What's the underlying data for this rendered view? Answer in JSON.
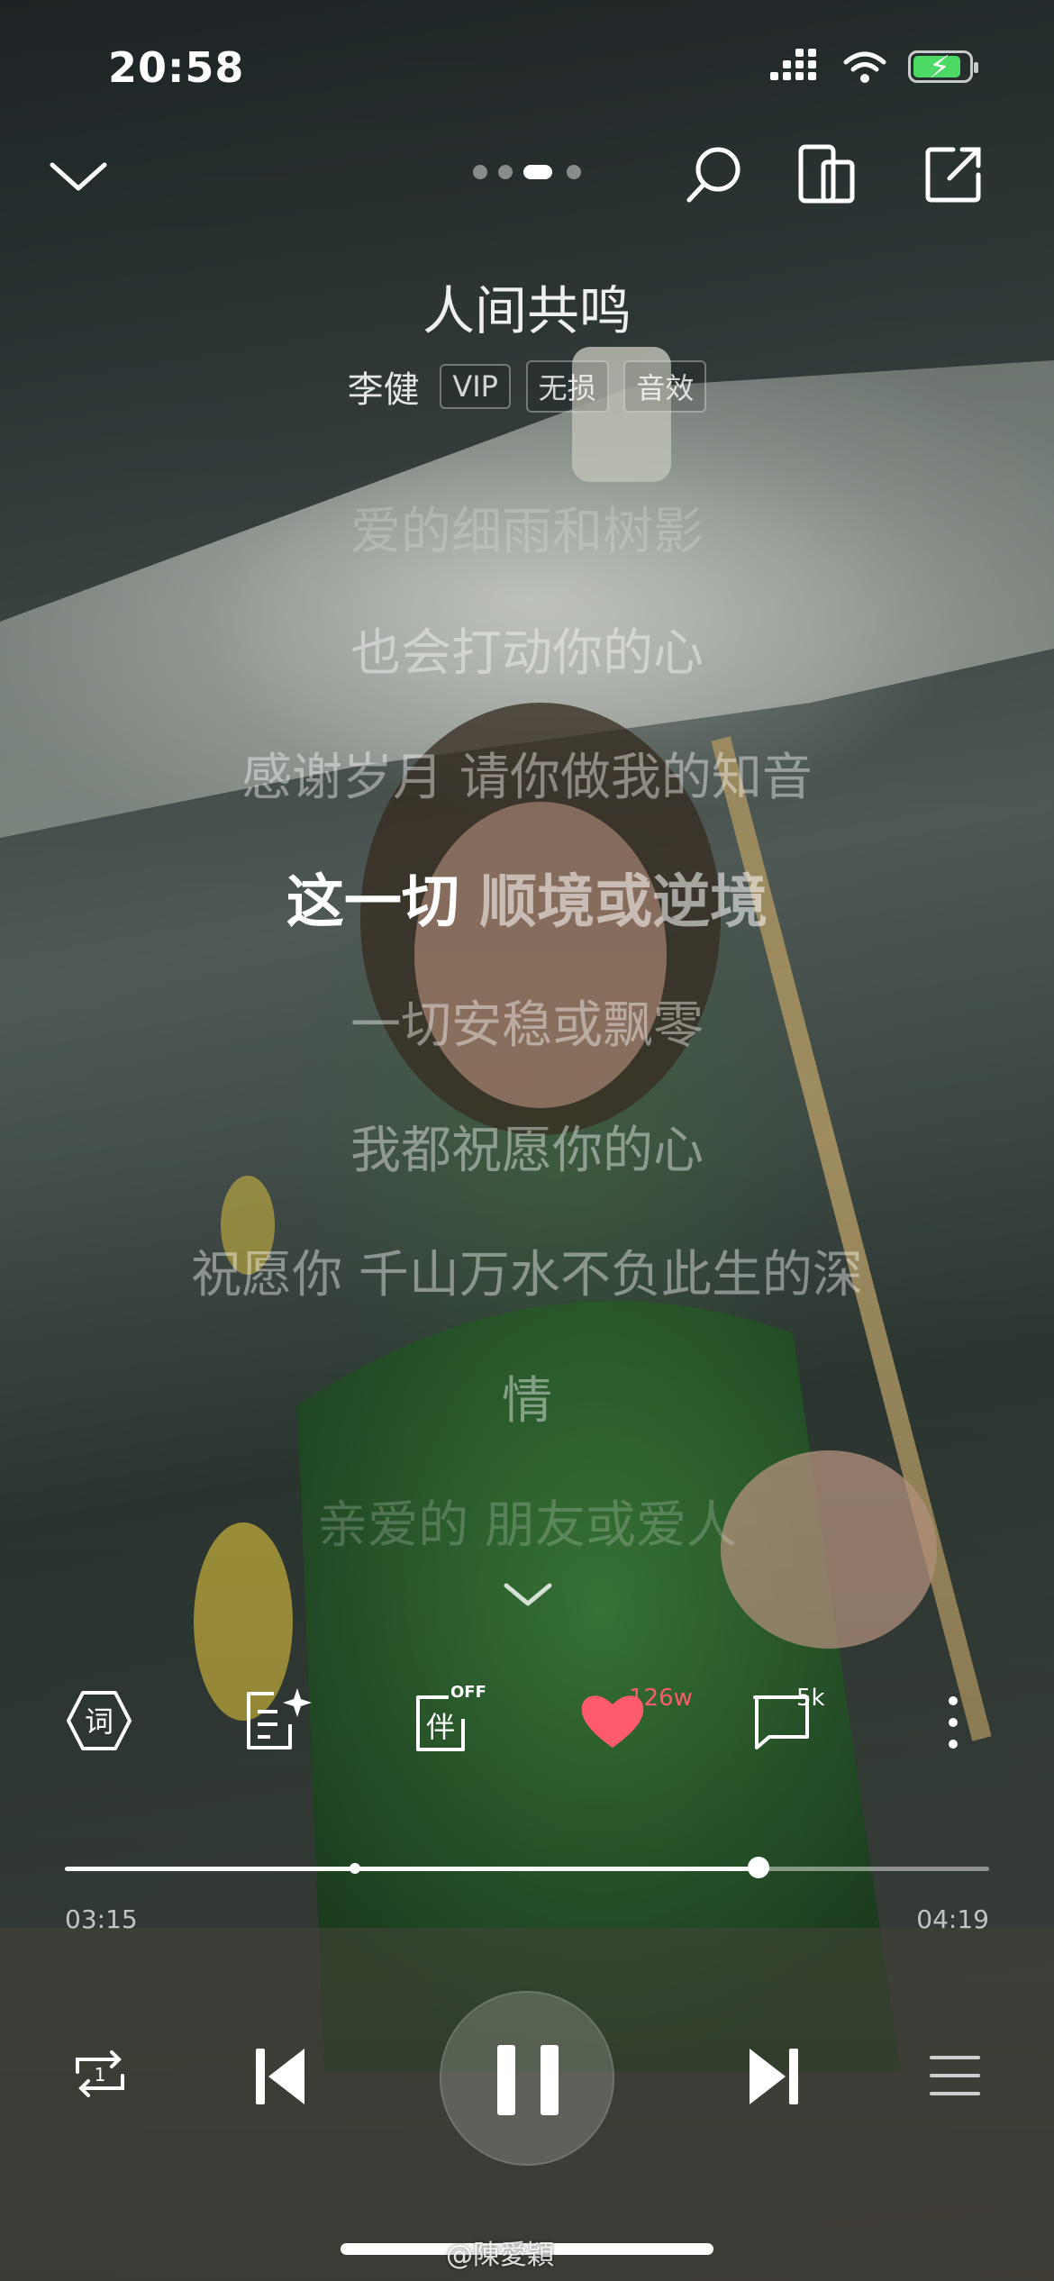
{
  "status_bar": {
    "time": "20:58"
  },
  "song": {
    "title": "人间共鸣",
    "artist": "李健",
    "tags": [
      "VIP",
      "无损",
      "音效"
    ]
  },
  "lyrics": {
    "lines": [
      "爱的细雨和树影",
      "也会打动你的心",
      "感谢岁月 请你做我的知音",
      "这一切 顺境或逆境",
      "一切安稳或飘零",
      "我都祝愿你的心",
      "祝愿你 千山万水不负此生的深",
      "情",
      "亲爱的 朋友或爱人"
    ],
    "current_sung": "这一切",
    "current_rest": " 顺境或逆境"
  },
  "actions": {
    "lyrics_icon_label": "词",
    "accompany_icon_label": "伴",
    "accompany_state": "OFF",
    "like_count": "126w",
    "comment_count": "5k"
  },
  "progress": {
    "current": "03:15",
    "total": "04:19",
    "played_fraction": 0.75
  },
  "colors": {
    "like": "#ff5a6e",
    "battery": "#4cd964"
  },
  "watermark": "@陳愛穎"
}
